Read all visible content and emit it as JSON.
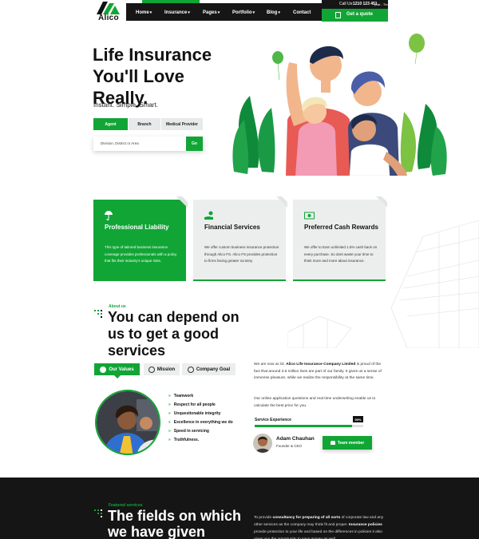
{
  "brand": {
    "name": "Alico",
    "accent": "#11a536",
    "dark": "#161616"
  },
  "nav": {
    "items": [
      {
        "label": "Home",
        "caret": "▾"
      },
      {
        "label": "Insurance",
        "caret": "▾"
      },
      {
        "label": "Pages",
        "caret": "▾"
      },
      {
        "label": "Portfolio",
        "caret": "▾"
      },
      {
        "label": "Blog",
        "caret": "▾"
      },
      {
        "label": "Contact",
        "caret": ""
      }
    ],
    "call_label": "Call Us:",
    "call_number": "1210 123 451",
    "call_hours": "(Sat - Thu)",
    "quote_button": "Get a quote"
  },
  "hero": {
    "title_lines": [
      "Life Insurance",
      "You'll Love",
      "Really."
    ],
    "subtitle": "Instant. Simple. Smart.",
    "tabs": [
      "Agent",
      "Branch",
      "Medical Provider"
    ],
    "active_tab": "Agent",
    "search_placeholder": "Division, District or Area",
    "go_button": "Go"
  },
  "cards": [
    {
      "title": "Professional Liability",
      "desc": "This type of tailored business insurance coverage provides professionals with a policy that fits their industry's unique risks.",
      "icon": "umbrella-icon"
    },
    {
      "title": "Financial Services",
      "desc": "We offer custom business insurance protection through Alico FS. Alico FS provides protection to firms facing greater scrutiny",
      "icon": "hand-coin-icon"
    },
    {
      "title": "Preferred Cash Rewards",
      "desc": "We offer to Earn unlimited 1.5% cash back on every purchase. So dont waste your time to think more and more about insurance.",
      "icon": "cash-icon"
    }
  ],
  "about": {
    "eyebrow": "About us",
    "title_lines": [
      "You can depend on",
      "us to get a good",
      "services"
    ],
    "tabs": [
      "Our Values",
      "Mission",
      "Company Goal"
    ],
    "values": [
      "Teamwork",
      "Respect for all people",
      "Unquestionable integrity",
      "Excellence in everything we do",
      "Speed in servicing",
      "Truthfulness."
    ],
    "para1_prefix": "We are now at 33.",
    "para1_bold": "Alico Life Insurance Company Limited",
    "para1_suffix": "is proud of the fact that around 3.5 million lives are part of our family. It gives us a sense of immense pleasure, while we realize the responsibility at the same time.",
    "para2": "Our online application questions and real time underwriting enable us to calculate the best price for you.",
    "service_label": "Service Experience",
    "service_value": 90,
    "service_pct_label": "90%",
    "founder_name": "Adam Chauhan",
    "founder_role": "Founder & CEO",
    "team_button": "Team member"
  },
  "services": {
    "eyebrow": "Featured services",
    "title_lines": [
      "The fields on which",
      "we have given"
    ],
    "para_prefix": "To provide",
    "para_bold1": "consultancy for preparing of all sorts",
    "para_mid": "of corporate law and any other services as the company may think fit and proper.",
    "para_bold2": "Insurance policies",
    "para_suffix": "provide protection to your life and based on the differences in policies it also gives you the opportunity to save money as well."
  }
}
